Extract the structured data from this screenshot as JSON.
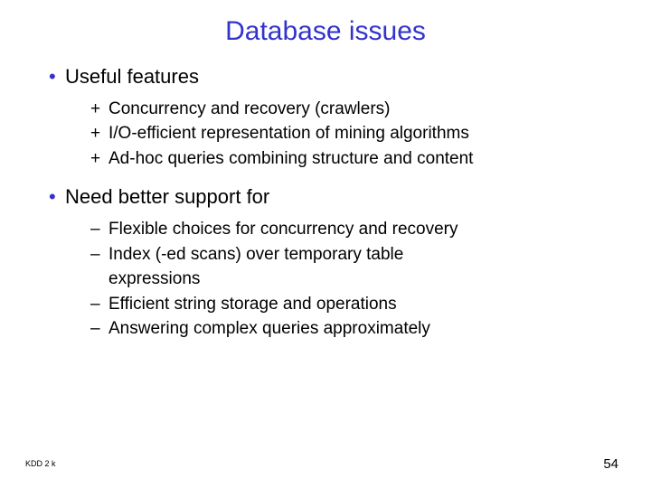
{
  "title": "Database issues",
  "sections": [
    {
      "heading": "Useful features",
      "marker": "•",
      "items": [
        {
          "marker": "+",
          "text": "Concurrency and recovery (crawlers)"
        },
        {
          "marker": "+",
          "text": "I/O-efficient representation of mining algorithms"
        },
        {
          "marker": "+",
          "text": "Ad-hoc queries combining structure and content"
        }
      ]
    },
    {
      "heading": "Need better support for",
      "marker": "•",
      "items": [
        {
          "marker": "–",
          "text": "Flexible choices for concurrency and recovery"
        },
        {
          "marker": "–",
          "text": "Index (-ed scans) over temporary table",
          "cont": "expressions"
        },
        {
          "marker": "–",
          "text": "Efficient string storage and operations"
        },
        {
          "marker": "–",
          "text": "Answering complex queries approximately"
        }
      ]
    }
  ],
  "footer": {
    "left": "KDD 2 k",
    "right": "54"
  }
}
